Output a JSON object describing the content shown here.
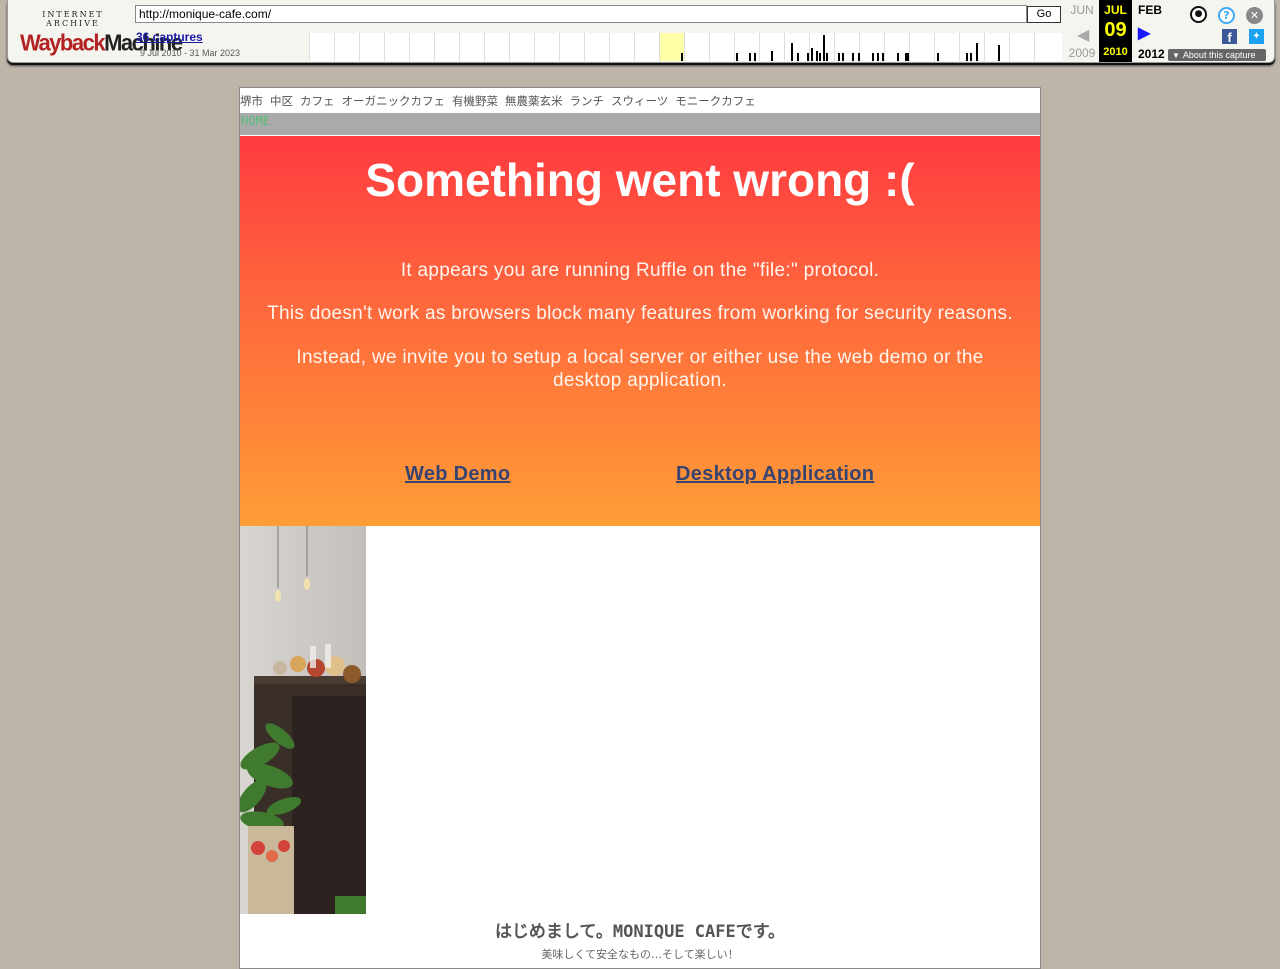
{
  "toolbar": {
    "logo_top": "INTERNET ARCHIVE",
    "logo_wayback": "Wayback",
    "logo_machine": "Machine",
    "url": "http://monique-cafe.com/",
    "go_label": "Go",
    "captures_label": "36 captures",
    "date_range": "9 Jul 2010 - 31 Mar 2023",
    "prev": {
      "month": "JUN",
      "year": "2009"
    },
    "current": {
      "month": "JUL",
      "day": "09",
      "year": "2010"
    },
    "next": {
      "month": "FEB",
      "year": "2012"
    },
    "about_label": "About this capture",
    "icons": {
      "user": "user-icon",
      "help": "help-icon",
      "close": "close-icon",
      "facebook": "facebook-icon",
      "twitter": "twitter-icon"
    },
    "colors": {
      "current_bg": "#000000",
      "current_fg": "#ffff00",
      "next_arrow": "#1a1aff"
    }
  },
  "site": {
    "keywords": [
      "堺市",
      "中区",
      "カフェ",
      "オーガニックカフェ",
      "有機野菜",
      "無農薬玄米",
      "ランチ",
      "スウィーツ",
      "モニークカフェ"
    ],
    "nav_home": "HOME",
    "welcome": "はじめまして。MONIQUE CAFEです。",
    "tagline": "美味しくて安全なもの…そして楽しい！"
  },
  "ruffle": {
    "title": "Something went wrong :(",
    "msg1": "It appears you are running Ruffle on the \"file:\" protocol.",
    "msg2": "This doesn't work as browsers block many features from working for security reasons.",
    "msg3": "Instead, we invite you to setup a local server or either use the web demo or the desktop application.",
    "link_demo": "Web Demo",
    "link_desktop": "Desktop Application"
  }
}
